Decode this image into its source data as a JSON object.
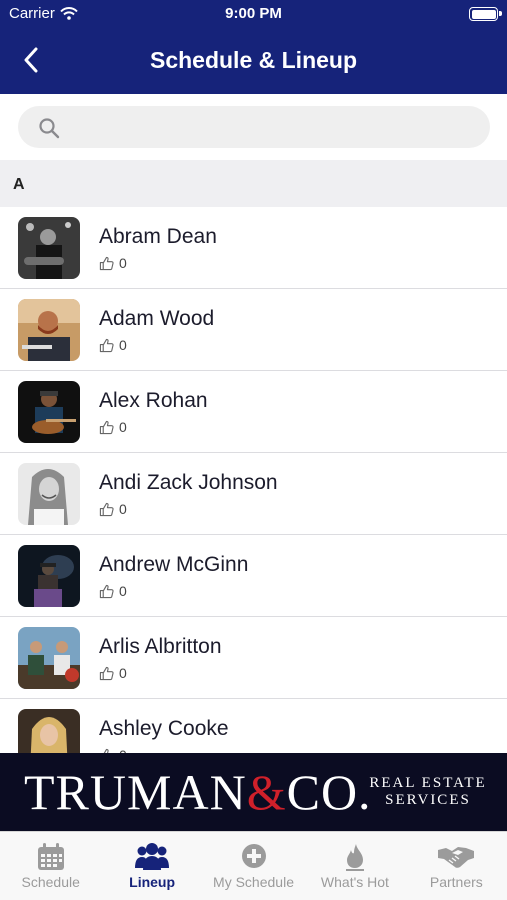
{
  "status_bar": {
    "carrier": "Carrier",
    "time": "9:00 PM"
  },
  "header": {
    "title": "Schedule & Lineup",
    "back_icon": "chevron-left-icon"
  },
  "search": {
    "placeholder": "",
    "value": "",
    "icon": "search-icon"
  },
  "section": {
    "letter": "A"
  },
  "artists": [
    {
      "name": "Abram Dean",
      "likes": "0"
    },
    {
      "name": "Adam Wood",
      "likes": "0"
    },
    {
      "name": "Alex Rohan",
      "likes": "0"
    },
    {
      "name": "Andi Zack Johnson",
      "likes": "0"
    },
    {
      "name": "Andrew McGinn",
      "likes": "0"
    },
    {
      "name": "Arlis Albritton",
      "likes": "0"
    },
    {
      "name": "Ashley Cooke",
      "likes": "0"
    }
  ],
  "banner": {
    "brand_left": "TRUMAN",
    "brand_amp": "&",
    "brand_right": "CO.",
    "tagline_1": "REAL ESTATE",
    "tagline_2": "SERVICES"
  },
  "tabs": [
    {
      "label": "Schedule",
      "icon": "calendar-icon",
      "active": false
    },
    {
      "label": "Lineup",
      "icon": "group-icon",
      "active": true
    },
    {
      "label": "My Schedule",
      "icon": "plus-circle-icon",
      "active": false
    },
    {
      "label": "What's Hot",
      "icon": "flame-icon",
      "active": false
    },
    {
      "label": "Partners",
      "icon": "handshake-icon",
      "active": false
    }
  ],
  "colors": {
    "primary": "#16237a",
    "banner": "#0b0c22",
    "accent_red": "#d0202a",
    "inactive": "#9b9b9b"
  }
}
